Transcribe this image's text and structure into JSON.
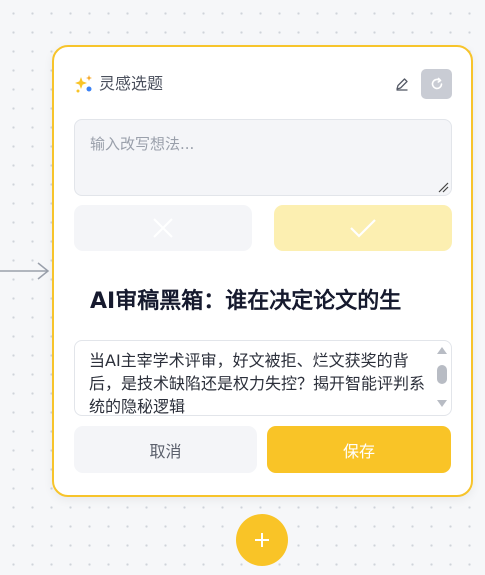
{
  "card": {
    "title": "灵感选题",
    "icon": "sparkle-icon",
    "edit_icon": "pencil-icon",
    "refresh_icon": "refresh-icon"
  },
  "rewrite": {
    "placeholder": "输入改写想法...",
    "value": ""
  },
  "actions": {
    "reject_icon": "close-icon",
    "accept_icon": "check-icon"
  },
  "topic": {
    "title": "AI审稿黑箱：谁在决定论文的生",
    "summary": "当AI主宰学术评审，好文被拒、烂文获奖的背后，是技术缺陷还是权力失控？揭开智能评判系统的隐秘逻辑"
  },
  "footer": {
    "cancel_label": "取消",
    "save_label": "保存"
  },
  "add_icon": "plus-icon",
  "colors": {
    "accent": "#f9c427",
    "accent_light": "#fcefb1",
    "border": "#f7c42b"
  }
}
